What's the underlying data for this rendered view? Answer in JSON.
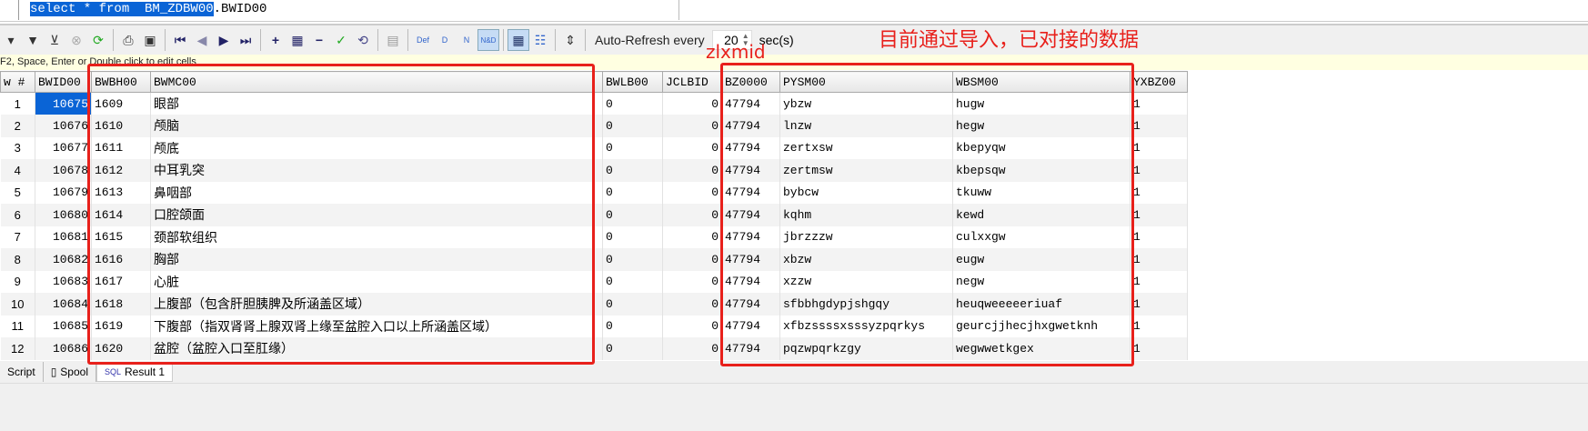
{
  "editor": {
    "sql_selected": "select * from  BM_ZDBW00",
    "sql_rest": ".BWID00"
  },
  "toolbar": {
    "icons": [
      "arrow-down-icon",
      "filter-icon",
      "clear-filter-icon",
      "cancel-icon",
      "refresh-icon",
      "print-icon",
      "save-icon",
      "first-record-icon",
      "prev-record-icon",
      "next-record-icon",
      "last-record-icon",
      "add-row-icon",
      "duplicate-row-icon",
      "delete-row-icon",
      "post-icon",
      "refresh-records-icon",
      "blob-icon",
      "def-icon",
      "d-icon",
      "n-icon",
      "nd-icon",
      "grid-view-icon",
      "form-view-icon",
      "fit-columns-icon"
    ],
    "glyphs": {
      "def": "Def",
      "d": "D",
      "n": "N",
      "nd": "N&D"
    },
    "auto_refresh_label": "Auto-Refresh every",
    "auto_refresh_value": "20",
    "auto_refresh_unit": "sec(s)"
  },
  "hint": "F2, Space, Enter or Double click to edit cells",
  "grid": {
    "columns": [
      "w #",
      "BWID00",
      "BWBH00",
      "BWMC00",
      "BWLB00",
      "JCLBID",
      "BZ0000",
      "PYSM00",
      "WBSM00",
      "YXBZ00"
    ],
    "rows": [
      [
        "1",
        "10675",
        "1609",
        "眼部",
        "0",
        "0",
        "47794",
        "ybzw",
        "hugw",
        "1"
      ],
      [
        "2",
        "10676",
        "1610",
        "颅脑",
        "0",
        "0",
        "47794",
        "lnzw",
        "hegw",
        "1"
      ],
      [
        "3",
        "10677",
        "1611",
        "颅底",
        "0",
        "0",
        "47794",
        "zertxsw",
        "kbepyqw",
        "1"
      ],
      [
        "4",
        "10678",
        "1612",
        "中耳乳突",
        "0",
        "0",
        "47794",
        "zertmsw",
        "kbepsqw",
        "1"
      ],
      [
        "5",
        "10679",
        "1613",
        "鼻咽部",
        "0",
        "0",
        "47794",
        "bybcw",
        "tkuww",
        "1"
      ],
      [
        "6",
        "10680",
        "1614",
        "口腔颌面",
        "0",
        "0",
        "47794",
        "kqhm",
        "kewd",
        "1"
      ],
      [
        "7",
        "10681",
        "1615",
        "颈部软组织",
        "0",
        "0",
        "47794",
        "jbrzzzw",
        "culxxgw",
        "1"
      ],
      [
        "8",
        "10682",
        "1616",
        "胸部",
        "0",
        "0",
        "47794",
        "xbzw",
        "eugw",
        "1"
      ],
      [
        "9",
        "10683",
        "1617",
        "心脏",
        "0",
        "0",
        "47794",
        "xzzw",
        "negw",
        "1"
      ],
      [
        "10",
        "10684",
        "1618",
        "上腹部（包含肝胆胰脾及所涵盖区域）",
        "0",
        "0",
        "47794",
        "sfbbhgdypjshgqy",
        "heuqweeeeeriuaf",
        "1"
      ],
      [
        "11",
        "10685",
        "1619",
        "下腹部（指双肾肾上腺双肾上缘至盆腔入口以上所涵盖区域）",
        "0",
        "0",
        "47794",
        "xfbzssssxsssyzpqrkys",
        "geurcjjhecjhxgwetknh",
        "1"
      ],
      [
        "12",
        "10686",
        "1620",
        "盆腔（盆腔入口至肛缘）",
        "0",
        "0",
        "47794",
        "pqzwpqrkzgy",
        "wegwwetkgex",
        "1"
      ]
    ]
  },
  "tabs": [
    {
      "label": "Script"
    },
    {
      "label": "Spool"
    },
    {
      "label": "Result 1",
      "active": true
    }
  ],
  "annotations": {
    "note": "目前通过导入，已对接的数据",
    "field": "zlxmid",
    "color": "#e8201b"
  },
  "colors": {
    "selection": "#0a64d6",
    "hint_bg": "#ffffe1"
  }
}
